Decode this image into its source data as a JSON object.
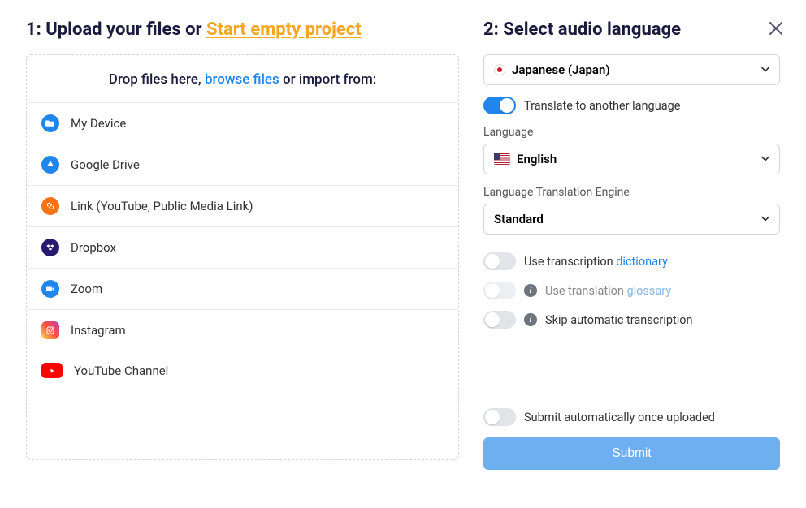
{
  "step1": {
    "title_prefix": "1: Upload your files or ",
    "empty_link": "Start empty project",
    "drop_prefix": "Drop files here, ",
    "browse": "browse files",
    "drop_suffix": " or import from:",
    "sources": [
      {
        "id": "my-device",
        "label": "My Device",
        "bg": "#2186eb"
      },
      {
        "id": "google-drive",
        "label": "Google Drive",
        "bg": "#2186eb"
      },
      {
        "id": "link",
        "label": "Link (YouTube, Public Media Link)",
        "bg": "#f97316"
      },
      {
        "id": "dropbox",
        "label": "Dropbox",
        "bg": "#2a1a6e"
      },
      {
        "id": "zoom",
        "label": "Zoom",
        "bg": "#2186eb"
      },
      {
        "id": "instagram",
        "label": "Instagram",
        "bg": "#e1306c"
      },
      {
        "id": "youtube-channel",
        "label": "YouTube Channel",
        "bg": "#ff0000"
      }
    ]
  },
  "step2": {
    "title": "2: Select audio language",
    "audio_language": "Japanese (Japan)",
    "translate_toggle": {
      "label": "Translate to another language",
      "on": true
    },
    "target_language_label": "Language",
    "target_language": "English",
    "engine_label": "Language Translation Engine",
    "engine": "Standard",
    "dictionary": {
      "prefix": "Use transcription ",
      "link": "dictionary",
      "on": false
    },
    "glossary": {
      "prefix": "Use translation ",
      "link": "glossary",
      "on": false,
      "disabled": true
    },
    "skip": {
      "label": "Skip automatic transcription",
      "on": false
    },
    "auto_submit": {
      "label": "Submit automatically once uploaded",
      "on": false
    },
    "submit": "Submit"
  }
}
